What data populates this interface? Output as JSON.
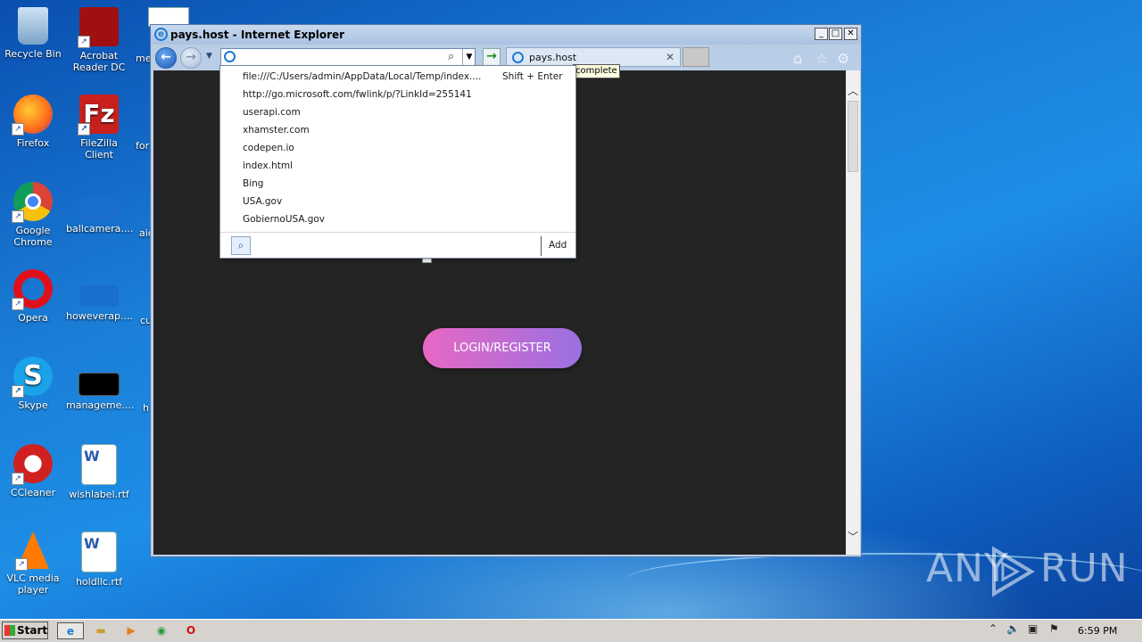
{
  "desktop": {
    "icons": [
      {
        "label": "Recycle Bin"
      },
      {
        "label": "Acrobat Reader DC"
      },
      {
        "label": "Firefox"
      },
      {
        "label": "FileZilla Client"
      },
      {
        "label": "Google Chrome"
      },
      {
        "label": "ballcamera...."
      },
      {
        "label": "Opera"
      },
      {
        "label": "howeverap...."
      },
      {
        "label": "Skype"
      },
      {
        "label": "manageme...."
      },
      {
        "label": "CCleaner"
      },
      {
        "label": "wishlabel.rtf"
      },
      {
        "label": "VLC media player"
      },
      {
        "label": "holdllc.rtf"
      }
    ],
    "partial_labels": [
      "me",
      "for",
      "aic",
      "cu",
      "h"
    ]
  },
  "window": {
    "title": "pays.host - Internet Explorer",
    "controls": {
      "minimize": "_",
      "maximize": "□",
      "close": "✕"
    },
    "address_value": "",
    "tab_label": "pays.host",
    "tooltip": "complete"
  },
  "dropdown": {
    "items": [
      "file:///C:/Users/admin/AppData/Local/Temp/index....",
      "http://go.microsoft.com/fwlink/p/?LinkId=255141",
      "userapi.com",
      "xhamster.com",
      "codepen.io",
      "index.html",
      "Bing",
      "USA.gov",
      "GobiernoUSA.gov"
    ],
    "shift_enter": "Shift + Enter",
    "add_label": "Add"
  },
  "page": {
    "login_button": "LOGIN/REGISTER"
  },
  "taskbar": {
    "start_label": "Start",
    "clock": "6:59 PM"
  },
  "watermark": {
    "text_left": "ANY",
    "text_right": "RUN"
  },
  "colors": {
    "login_gradient_start": "#e868c4",
    "login_gradient_end": "#9a70e2",
    "content_bg": "#242424"
  }
}
